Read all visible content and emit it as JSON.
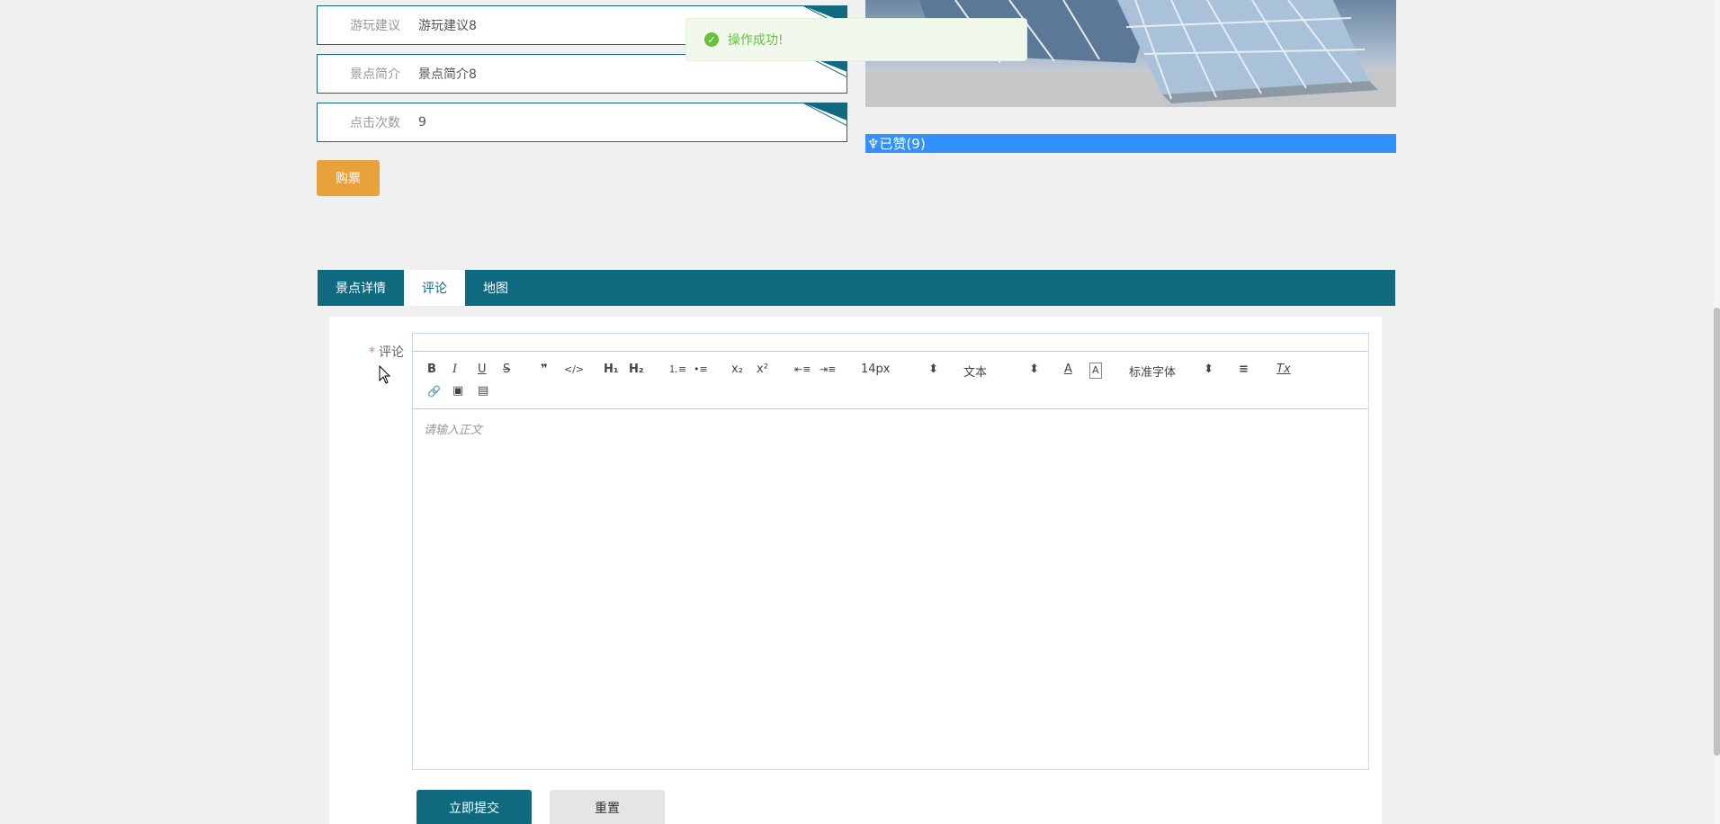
{
  "info": [
    {
      "label": "游玩建议",
      "value": "游玩建议8"
    },
    {
      "label": "景点简介",
      "value": "景点简介8"
    },
    {
      "label": "点击次数",
      "value": "9"
    }
  ],
  "buy_label": "购票",
  "like_label": "♆已赞(9)",
  "toast": {
    "message": "操作成功!",
    "icon": "check-icon",
    "color": "#67c23a"
  },
  "tabs": [
    {
      "label": "景点详情"
    },
    {
      "label": "评论"
    },
    {
      "label": "地图"
    }
  ],
  "form": {
    "comment_label": "评论",
    "required_mark": "*",
    "placeholder": "请输入正文",
    "submit_label": "立即提交",
    "reset_label": "重置"
  },
  "toolbar": {
    "bold": "B",
    "italic": "I",
    "underline": "U",
    "strike": "S",
    "quote": "❞",
    "code": "</>",
    "h1": "H₁",
    "h2": "H₂",
    "ordered": "⒈≡",
    "bullet": "•≡",
    "sub": "x₂",
    "sup": "x²",
    "outdent": "⇤≡",
    "indent": "⇥≡",
    "size": "14px",
    "header": "文本",
    "font": "标准字体",
    "align": "≡",
    "clean": "Tx",
    "color": "A",
    "background": "A",
    "link": "🔗",
    "image": "▣",
    "video": "▤"
  },
  "colors": {
    "primary": "#0f6a80",
    "buy": "#e8a23c",
    "like": "#3390ff"
  }
}
